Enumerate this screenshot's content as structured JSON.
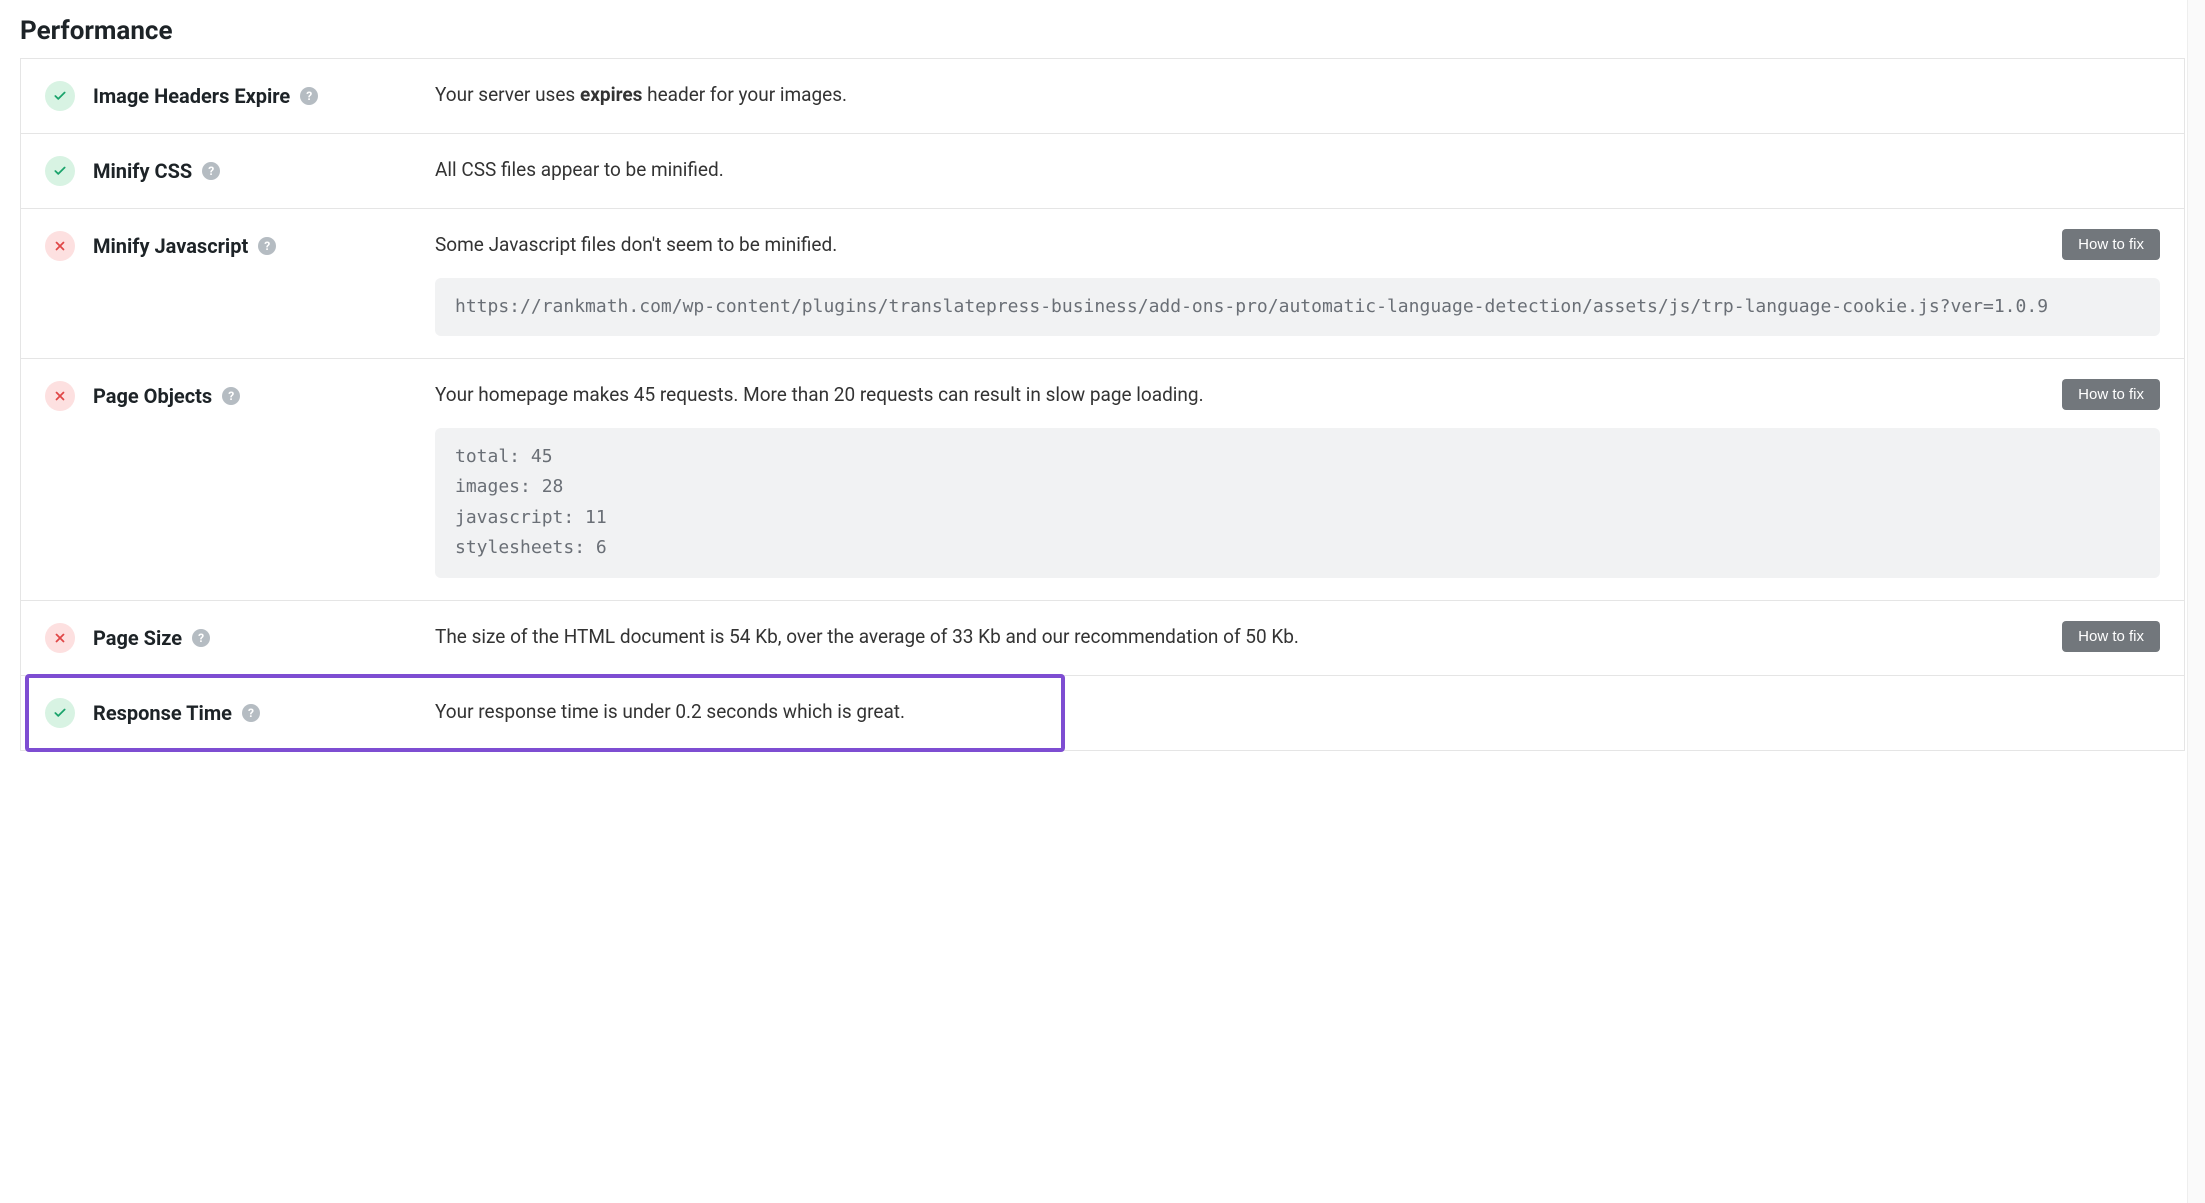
{
  "section": {
    "title": "Performance"
  },
  "btn": {
    "fix": "How to fix"
  },
  "checks": {
    "imageHeaders": {
      "label": "Image Headers Expire",
      "desc_pre": "Your server uses ",
      "desc_bold": "expires",
      "desc_post": " header for your images."
    },
    "minifyCss": {
      "label": "Minify CSS",
      "desc": "All CSS files appear to be minified."
    },
    "minifyJs": {
      "label": "Minify Javascript",
      "desc": "Some Javascript files don't seem to be minified.",
      "code": "https://rankmath.com/wp-content/plugins/translatepress-business/add-ons-pro/automatic-language-detection/assets/js/trp-language-cookie.js?ver=1.0.9"
    },
    "pageObjects": {
      "label": "Page Objects",
      "desc": "Your homepage makes 45 requests. More than 20 requests can result in slow page loading.",
      "code": "total: 45\nimages: 28\njavascript: 11\nstylesheets: 6"
    },
    "pageSize": {
      "label": "Page Size",
      "desc": "The size of the HTML document is 54 Kb, over the average of 33 Kb and our recommendation of 50 Kb."
    },
    "responseTime": {
      "label": "Response Time",
      "desc": "Your response time is under 0.2 seconds which is great."
    }
  }
}
